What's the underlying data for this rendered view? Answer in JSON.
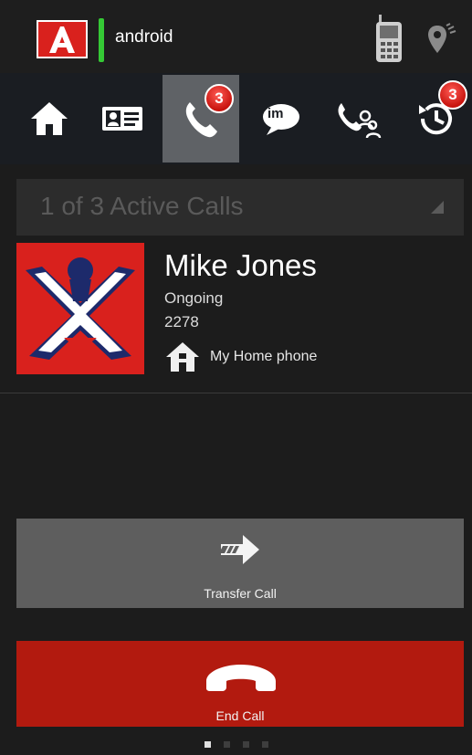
{
  "statusbar": {
    "account_label": "android",
    "logo_letter": "A"
  },
  "toolbar": {
    "items": [
      {
        "icon": "home-icon"
      },
      {
        "icon": "contact-card-icon"
      },
      {
        "icon": "phone-icon",
        "badge": "3",
        "active": true
      },
      {
        "icon": "im-icon",
        "label": "im"
      },
      {
        "icon": "conference-call-icon"
      },
      {
        "icon": "call-history-icon",
        "badge": "3"
      }
    ]
  },
  "active_calls": {
    "label": "1 of 3 Active Calls"
  },
  "contact": {
    "name": "Mike Jones",
    "status": "Ongoing",
    "number": "2278",
    "phone_type": "My Home phone"
  },
  "actions": {
    "transfer_label": "Transfer Call",
    "end_call_label": "End Call"
  },
  "colors": {
    "end_call": "#b21a0f",
    "transfer": "#5e5e5e",
    "badge": "#d9211d",
    "accent_green": "#35c935"
  },
  "pager": {
    "count": 4,
    "active_index": 0
  }
}
